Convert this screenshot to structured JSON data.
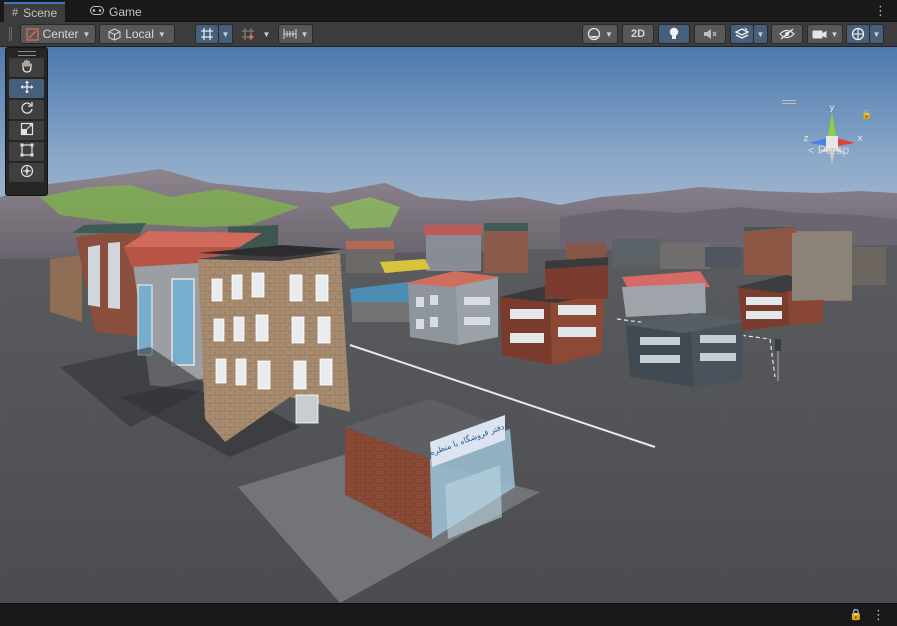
{
  "tabs": [
    {
      "label": "Scene",
      "icon": "hash-grid-icon",
      "active": true
    },
    {
      "label": "Game",
      "icon": "gamepad-icon",
      "active": false
    }
  ],
  "toolbar": {
    "pivot_label": "Center",
    "space_label": "Local",
    "mode_2d_label": "2D"
  },
  "gizmo": {
    "y_label": "y",
    "x_label": "x",
    "z_label": "z",
    "projection_label": "Persp"
  },
  "scene": {
    "shop_sign_text": "دفتر فروشگاه با منظره"
  },
  "colors": {
    "accent": "#3a79bb",
    "active_button": "#46607c",
    "toolbar_bg": "#3c3c3c",
    "axis_y": "#8ccf43",
    "axis_x": "#e2403a",
    "axis_z": "#4f7fe0"
  }
}
